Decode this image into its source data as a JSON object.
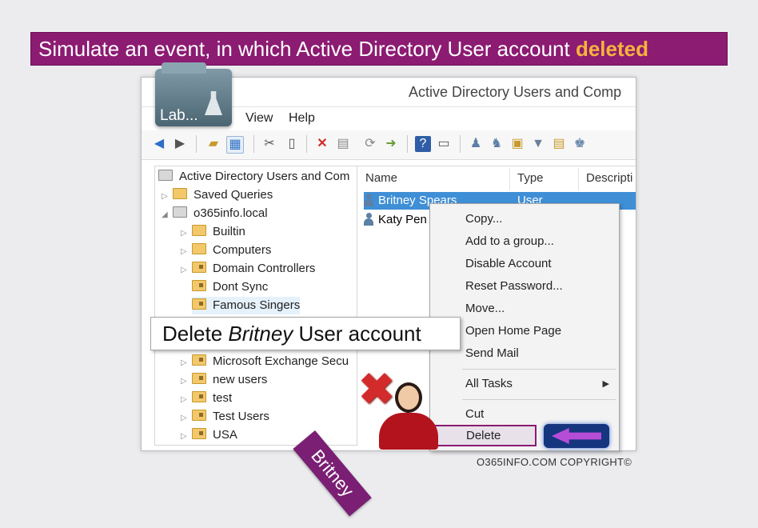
{
  "banner": {
    "prefix": "Simulate an event, in which Active Directory User account ",
    "highlight": "deleted",
    "highlight_color": "#f6b33d",
    "background": "#8c1b72"
  },
  "window": {
    "title": "Active Directory Users and Comp",
    "badge_label": "Lab...",
    "menu": [
      "View",
      "Help"
    ],
    "toolbar_icons": [
      "back-icon",
      "forward-icon",
      "up-folder-icon",
      "console-tree-icon",
      "cut-icon",
      "copy-icon",
      "delete-icon",
      "properties-icon",
      "refresh-icon",
      "export-icon",
      "help-icon",
      "show-icon",
      "users-icon",
      "group-icon",
      "ou-icon",
      "filter-icon",
      "find-icon",
      "add-member-icon"
    ]
  },
  "tree": {
    "items": [
      {
        "label": "Active Directory Users and Com",
        "icon": "snapin-icon",
        "indent": 0
      },
      {
        "label": "Saved Queries",
        "icon": "folder-icon",
        "indent": 1
      },
      {
        "label": "o365info.local",
        "icon": "domain-icon",
        "indent": 1
      },
      {
        "label": "Builtin",
        "icon": "folder-icon",
        "indent": 2
      },
      {
        "label": "Computers",
        "icon": "folder-icon",
        "indent": 2
      },
      {
        "label": "Domain Controllers",
        "icon": "ou-icon",
        "indent": 2
      },
      {
        "label": "Dont Sync",
        "icon": "ou-icon",
        "indent": 2
      },
      {
        "label": "Famous Singers",
        "icon": "ou-icon",
        "indent": 2
      },
      {
        "label": "Microsoft Exchange Secu",
        "icon": "ou-icon",
        "indent": 2
      },
      {
        "label": "new users",
        "icon": "ou-icon",
        "indent": 2
      },
      {
        "label": "test",
        "icon": "ou-icon",
        "indent": 2
      },
      {
        "label": "Test Users",
        "icon": "ou-icon",
        "indent": 2
      },
      {
        "label": "USA",
        "icon": "ou-icon",
        "indent": 2
      }
    ]
  },
  "list": {
    "columns": [
      "Name",
      "Type",
      "Descripti"
    ],
    "rows": [
      {
        "name": "Britney Spears",
        "type": "User"
      },
      {
        "name": "Katy Pen",
        "type": ""
      }
    ]
  },
  "context_menu": {
    "items": [
      "Copy...",
      "Add to a group...",
      "Disable Account",
      "Reset Password...",
      "Move...",
      "Open Home Page",
      "Send Mail",
      "All Tasks",
      "Cut",
      "Delete"
    ]
  },
  "callout": {
    "prefix": "Delete ",
    "emphasis": "Britney",
    "suffix": " User account"
  },
  "name_tag": "Britney",
  "copyright": "O365INFO.COM COPYRIGHT©"
}
